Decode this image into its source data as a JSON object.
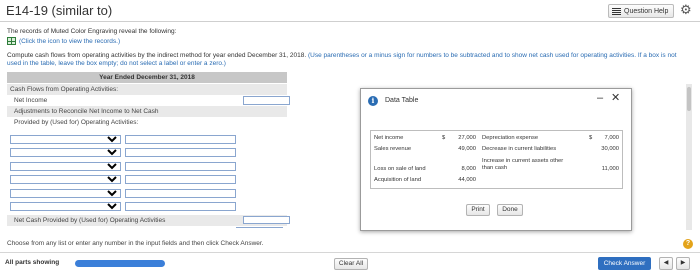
{
  "header": {
    "title": "E14-19 (similar to)",
    "question_help": "Question Help",
    "settings_icon": "gear-icon"
  },
  "intro": {
    "text": "The records of Muted Color Engraving reveal the following:",
    "link": "(Click the icon to view the records.)",
    "link_icon": "spreadsheet-icon"
  },
  "instructions": {
    "main": "Compute cash flows from operating activities by the indirect method for year ended December 31, 2018.",
    "hint": "(Use parentheses or a minus sign for numbers to be subtracted and to show net cash used for operating activities. If a box is not used in the table, leave the box empty; do not select a label or enter a zero.)"
  },
  "statement": {
    "header": "Year Ended December 31, 2018",
    "rows": [
      "Cash Flows from Operating Activities:",
      "Net Income",
      "Adjustments to Reconcile Net Income to Net Cash",
      "Provided by (Used for) Operating Activities:"
    ],
    "net_cash_label": "Net Cash Provided by (Used for) Operating Activities",
    "inputs": {
      "net_income": "",
      "net_cash": ""
    }
  },
  "dialog": {
    "title": "Data Table",
    "table": {
      "left": [
        {
          "label": "Net income",
          "prefix": "$",
          "value": "27,000"
        },
        {
          "label": "Sales revenue",
          "prefix": "",
          "value": "49,000"
        },
        {
          "label": "Loss on sale of land",
          "prefix": "",
          "value": "8,000"
        },
        {
          "label": "Acquisition of land",
          "prefix": "",
          "value": "44,000"
        }
      ],
      "right": [
        {
          "label": "Depreciation expense",
          "prefix": "$",
          "value": "7,000"
        },
        {
          "label": "Decrease in current liabilities",
          "prefix": "",
          "value": "30,000"
        },
        {
          "label": "Increase in current assets other",
          "label2": "than cash",
          "prefix": "",
          "value": "11,000"
        }
      ]
    },
    "print_label": "Print",
    "done_label": "Done",
    "minimize": "–",
    "close": "✕"
  },
  "footer": {
    "note": "Choose from any list or enter any number in the input fields and then click Check Answer.",
    "help_mark": "?"
  },
  "bottombar": {
    "parts_label": "All parts showing",
    "clear_all": "Clear All",
    "check_answer": "Check Answer",
    "prev": "◀",
    "next": "▶"
  }
}
